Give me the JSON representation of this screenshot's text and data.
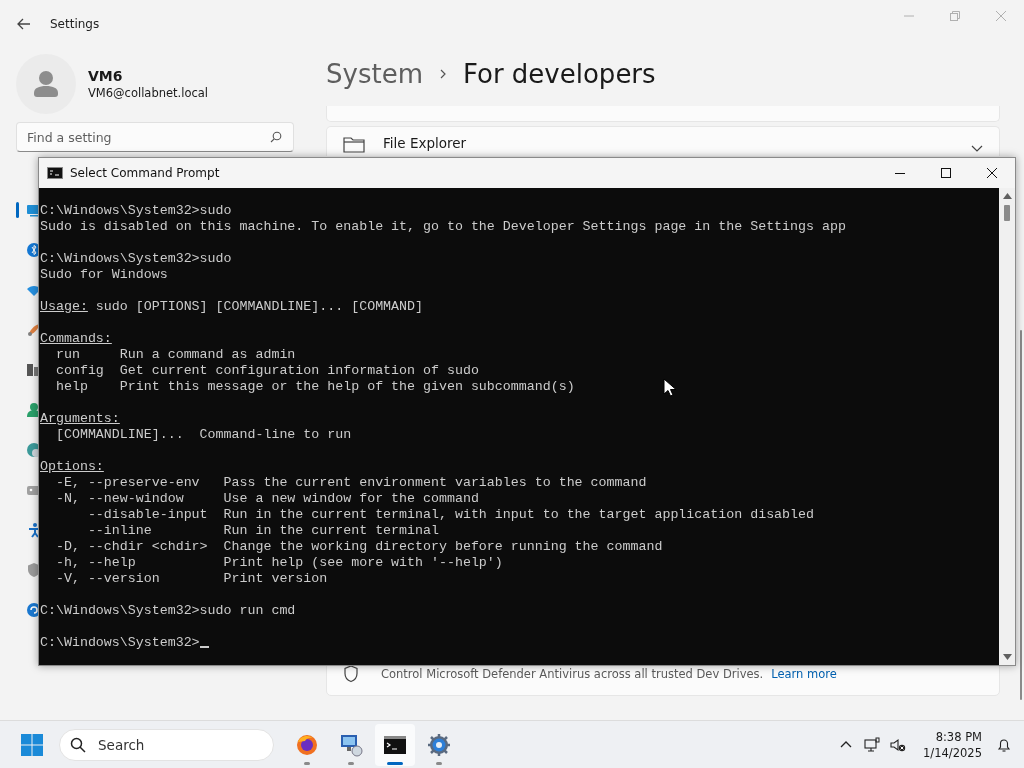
{
  "settings": {
    "title": "Settings",
    "profile": {
      "name": "VM6",
      "email": "VM6@collabnet.local"
    },
    "search": {
      "placeholder": "Find a setting"
    },
    "sidebar": {
      "items": [
        {
          "selected": true
        },
        {
          "selected": false
        },
        {
          "selected": false
        },
        {
          "selected": false
        },
        {
          "selected": false
        },
        {
          "selected": false
        },
        {
          "selected": false
        },
        {
          "selected": false
        },
        {
          "selected": false
        },
        {
          "selected": false
        },
        {
          "selected": false
        }
      ]
    },
    "breadcrumb": {
      "parent": "System",
      "current": "For developers"
    },
    "cards": [
      {
        "kind": "blank"
      },
      {
        "kind": "setting",
        "title": "File Explorer"
      },
      {
        "kind": "description",
        "text": "Control Microsoft Defender Antivirus across all trusted Dev Drives.",
        "link": "Learn more"
      }
    ]
  },
  "console": {
    "title": "Select Command Prompt",
    "lines": [
      {
        "kind": "plain",
        "text": "C:\\Windows\\System32>sudo"
      },
      {
        "kind": "plain",
        "text": "Sudo is disabled on this machine. To enable it, go to the Developer Settings page in the Settings app"
      },
      {
        "kind": "blank"
      },
      {
        "kind": "plain",
        "text": "C:\\Windows\\System32>sudo"
      },
      {
        "kind": "plain",
        "text": "Sudo for Windows"
      },
      {
        "kind": "blank"
      },
      {
        "kind": "heading",
        "label": "Usage:",
        "text": "sudo [OPTIONS] [COMMANDLINE]... [COMMAND]"
      },
      {
        "kind": "blank"
      },
      {
        "kind": "heading",
        "label": "Commands:"
      },
      {
        "kind": "plain",
        "text": "  run     Run a command as admin"
      },
      {
        "kind": "plain",
        "text": "  config  Get current configuration information of sudo"
      },
      {
        "kind": "plain",
        "text": "  help    Print this message or the help of the given subcommand(s)"
      },
      {
        "kind": "blank"
      },
      {
        "kind": "heading",
        "label": "Arguments:"
      },
      {
        "kind": "plain",
        "text": "  [COMMANDLINE]...  Command-line to run"
      },
      {
        "kind": "blank"
      },
      {
        "kind": "heading",
        "label": "Options:"
      },
      {
        "kind": "plain",
        "text": "  -E, --preserve-env   Pass the current environment variables to the command"
      },
      {
        "kind": "plain",
        "text": "  -N, --new-window     Use a new window for the command"
      },
      {
        "kind": "plain",
        "text": "      --disable-input  Run in the current terminal, with input to the target application disabled"
      },
      {
        "kind": "plain",
        "text": "      --inline         Run in the current terminal"
      },
      {
        "kind": "plain",
        "text": "  -D, --chdir <chdir>  Change the working directory before running the command"
      },
      {
        "kind": "plain",
        "text": "  -h, --help           Print help (see more with '--help')"
      },
      {
        "kind": "plain",
        "text": "  -V, --version        Print version"
      },
      {
        "kind": "blank"
      },
      {
        "kind": "plain",
        "text": "C:\\Windows\\System32>sudo run cmd"
      },
      {
        "kind": "blank"
      },
      {
        "kind": "prompt",
        "text": "C:\\Windows\\System32>",
        "cursor": true
      }
    ]
  },
  "taskbar": {
    "search": {
      "placeholder": "Search"
    },
    "apps": [
      {
        "kind": "browser",
        "running": true,
        "active": false
      },
      {
        "kind": "remote",
        "running": true,
        "active": false
      },
      {
        "kind": "terminal",
        "running": true,
        "active": true
      },
      {
        "kind": "settings",
        "running": true,
        "active": false
      }
    ],
    "clock": {
      "time": "8:38 PM",
      "date": "1/14/2025"
    }
  }
}
